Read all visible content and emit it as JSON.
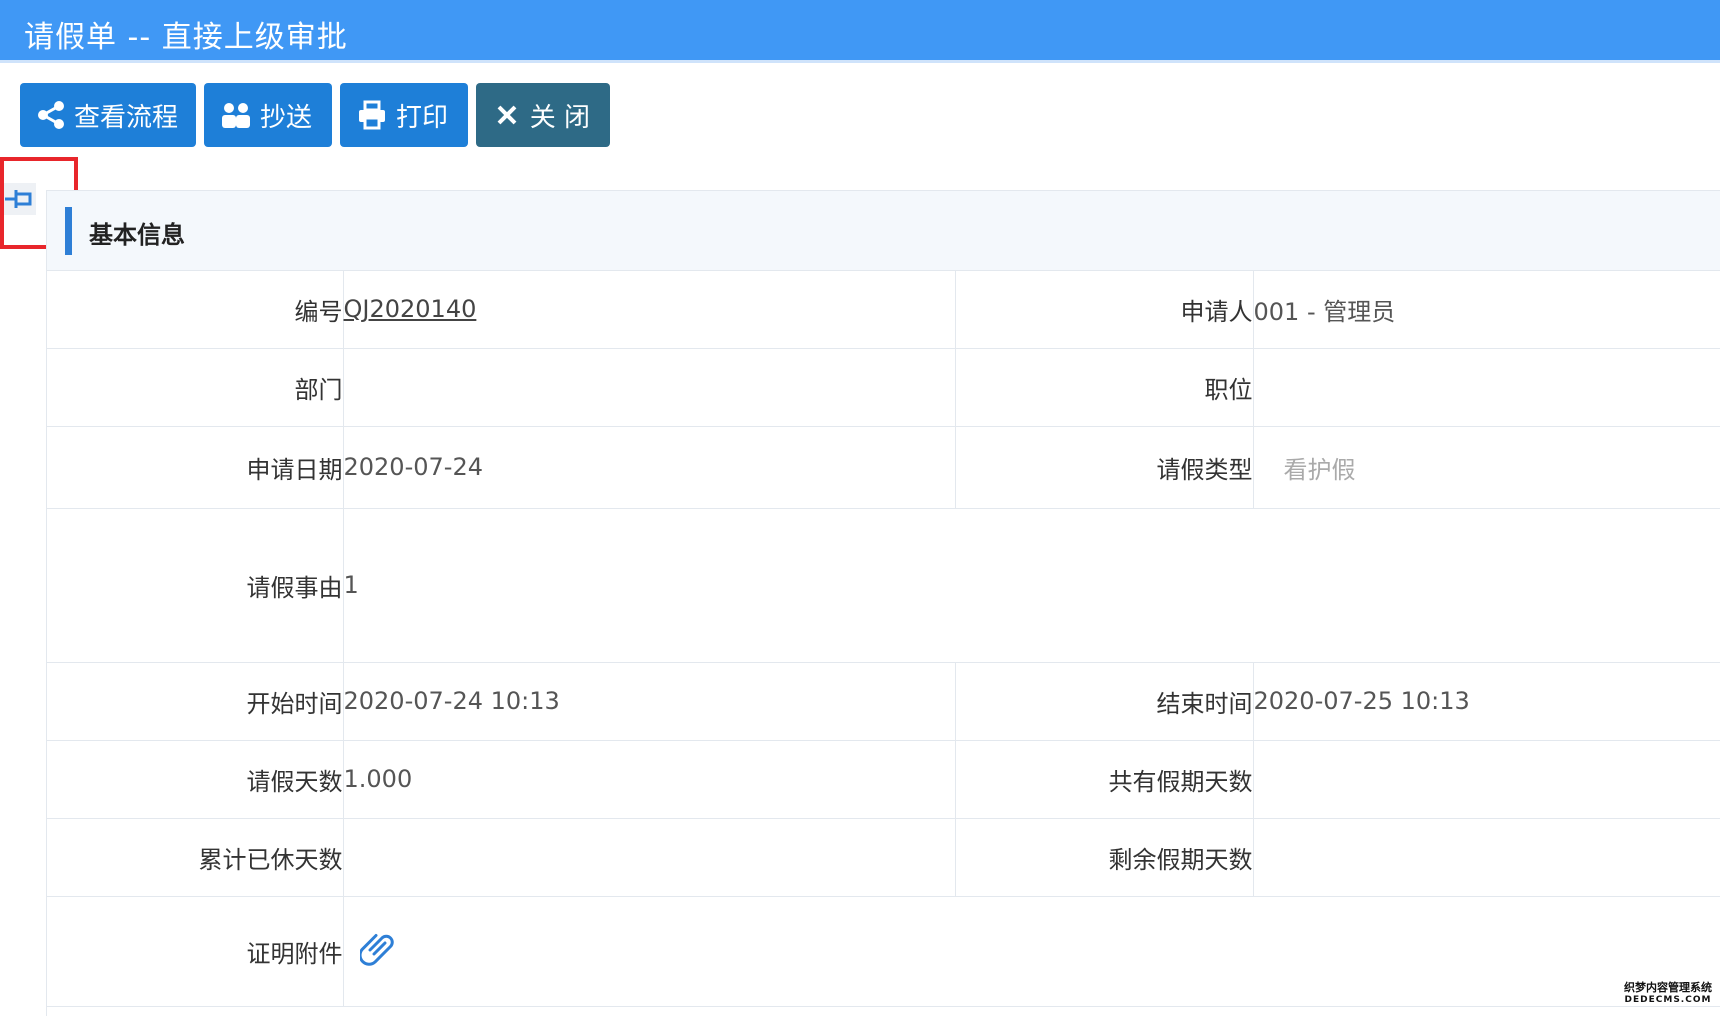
{
  "window": {
    "title": "请假单 -- 直接上级审批"
  },
  "toolbar": {
    "view_flow": "查看流程",
    "cc": "抄送",
    "print": "打印",
    "close": "关 闭"
  },
  "section": {
    "title": "基本信息"
  },
  "form": {
    "number_label": "编号",
    "number_value": "QJ2020140",
    "applicant_label": "申请人",
    "applicant_value": "001 - 管理员",
    "department_label": "部门",
    "department_value": "",
    "position_label": "职位",
    "position_value": "",
    "apply_date_label": "申请日期",
    "apply_date_value": "2020-07-24",
    "leave_type_label": "请假类型",
    "leave_type_value": "看护假",
    "reason_label": "请假事由",
    "reason_value": "1",
    "start_time_label": "开始时间",
    "start_time_value": "2020-07-24 10:13",
    "end_time_label": "结束时间",
    "end_time_value": "2020-07-25 10:13",
    "leave_days_label": "请假天数",
    "leave_days_value": "1.000",
    "total_holiday_label": "共有假期天数",
    "total_holiday_value": "",
    "used_days_label": "累计已休天数",
    "used_days_value": "",
    "remaining_days_label": "剩余假期天数",
    "remaining_days_value": "",
    "attachment_label": "证明附件"
  },
  "watermark": {
    "line1": "织梦内容管理系统",
    "line2": "DEDECMS.COM"
  },
  "colors": {
    "titlebar": "#4098f5",
    "button": "#1e7fd8",
    "close_button": "#2e6a86",
    "highlight": "#e8262b",
    "accent": "#2e7fd6"
  }
}
